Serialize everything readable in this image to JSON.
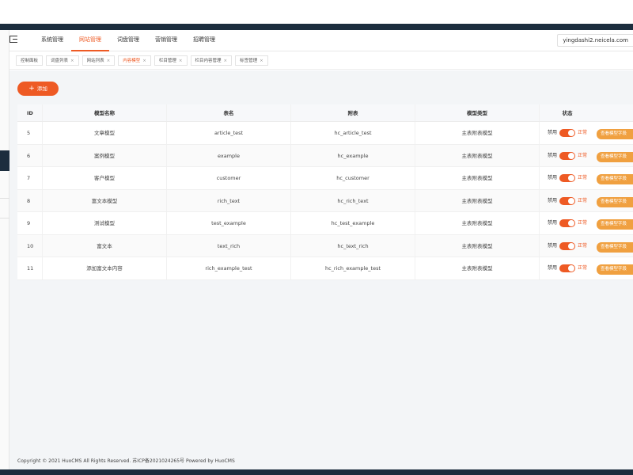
{
  "header": {
    "nav": [
      "系统管理",
      "网站管理",
      "词盘管理",
      "营销管理",
      "招聘管理"
    ],
    "active_nav": 1,
    "domain": "yingdashi2.neicela.com"
  },
  "tabs": [
    {
      "label": "控制面板",
      "closable": false
    },
    {
      "label": "词盘列表",
      "closable": true
    },
    {
      "label": "网站列表",
      "closable": true
    },
    {
      "label": "内容模型",
      "closable": true,
      "active": true
    },
    {
      "label": "栏目管理",
      "closable": true
    },
    {
      "label": "栏目内容管理",
      "closable": true
    },
    {
      "label": "标签管理",
      "closable": true
    }
  ],
  "toolbar": {
    "add_label": "添加"
  },
  "table": {
    "columns": [
      "ID",
      "模型名称",
      "表名",
      "附表",
      "模型类型",
      "状态"
    ],
    "rows": [
      {
        "id": "5",
        "name": "文章模型",
        "table": "article_test",
        "sub": "hc_article_test",
        "type": "主表附表模型",
        "status_off": "禁用",
        "status_on": "正常",
        "action": "查看模型字段"
      },
      {
        "id": "6",
        "name": "案例模型",
        "table": "example",
        "sub": "hc_example",
        "type": "主表附表模型",
        "status_off": "禁用",
        "status_on": "正常",
        "action": "查看模型字段"
      },
      {
        "id": "7",
        "name": "客户模型",
        "table": "customer",
        "sub": "hc_customer",
        "type": "主表附表模型",
        "status_off": "禁用",
        "status_on": "正常",
        "action": "查看模型字段"
      },
      {
        "id": "8",
        "name": "富文本模型",
        "table": "rich_text",
        "sub": "hc_rich_text",
        "type": "主表附表模型",
        "status_off": "禁用",
        "status_on": "正常",
        "action": "查看模型字段"
      },
      {
        "id": "9",
        "name": "测试模型",
        "table": "test_example",
        "sub": "hc_test_example",
        "type": "主表附表模型",
        "status_off": "禁用",
        "status_on": "正常",
        "action": "查看模型字段"
      },
      {
        "id": "10",
        "name": "富文本",
        "table": "text_rich",
        "sub": "hc_text_rich",
        "type": "主表附表模型",
        "status_off": "禁用",
        "status_on": "正常",
        "action": "查看模型字段"
      },
      {
        "id": "11",
        "name": "添加富文本内容",
        "table": "rich_example_test",
        "sub": "hc_rich_example_test",
        "type": "主表附表模型",
        "status_off": "禁用",
        "status_on": "正常",
        "action": "查看模型字段"
      }
    ]
  },
  "footer": {
    "text": "Copyright © 2021 HuoCMS All Rights Reserved. 苏ICP备2021024265号 Powered by HuoCMS"
  },
  "colors": {
    "accent": "#ee5a24",
    "action": "#f0a040",
    "dark": "#1c2d3e"
  }
}
